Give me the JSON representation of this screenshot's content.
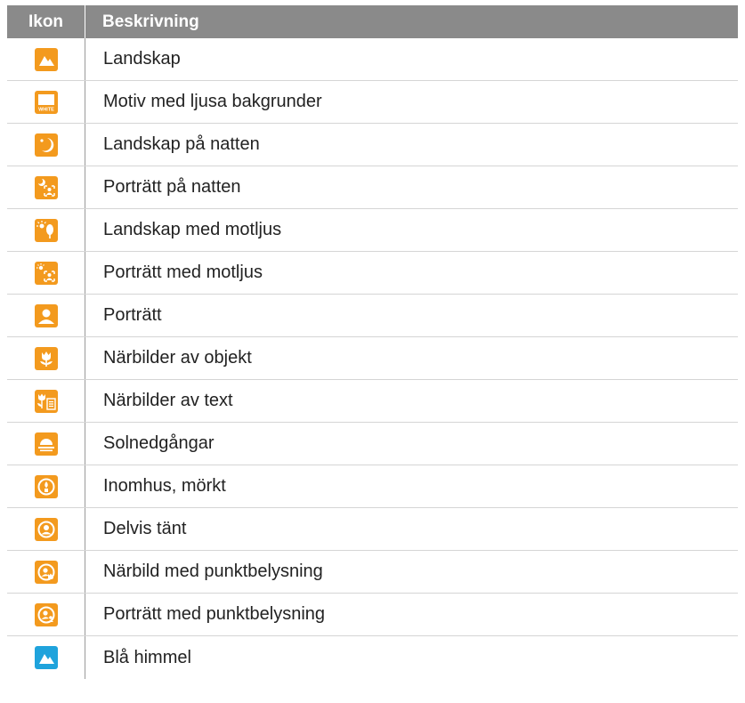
{
  "header": {
    "col_icon": "Ikon",
    "col_desc": "Beskrivning"
  },
  "colors": {
    "orange": "#f39a1e",
    "blue": "#1fa3dc",
    "header_bg": "#8a8a8a"
  },
  "rows": [
    {
      "icon": "landscape-icon",
      "label": "Landskap"
    },
    {
      "icon": "white-background-icon",
      "label": "Motiv med ljusa bakgrunder",
      "icon_text": "WHITE"
    },
    {
      "icon": "night-landscape-icon",
      "label": "Landskap på natten"
    },
    {
      "icon": "night-portrait-icon",
      "label": "Porträtt på natten"
    },
    {
      "icon": "backlight-landscape-icon",
      "label": "Landskap med motljus"
    },
    {
      "icon": "backlight-portrait-icon",
      "label": "Porträtt med motljus"
    },
    {
      "icon": "portrait-icon",
      "label": "Porträtt"
    },
    {
      "icon": "macro-flower-icon",
      "label": "Närbilder av objekt"
    },
    {
      "icon": "macro-text-icon",
      "label": "Närbilder av text"
    },
    {
      "icon": "sunset-icon",
      "label": "Solnedgångar"
    },
    {
      "icon": "indoor-dark-icon",
      "label": "Inomhus, mörkt"
    },
    {
      "icon": "partly-lit-icon",
      "label": "Delvis tänt"
    },
    {
      "icon": "spotlight-macro-icon",
      "label": "Närbild med punktbelysning"
    },
    {
      "icon": "spotlight-portrait-icon",
      "label": "Porträtt med punktbelysning"
    },
    {
      "icon": "blue-sky-icon",
      "label": "Blå himmel"
    }
  ]
}
